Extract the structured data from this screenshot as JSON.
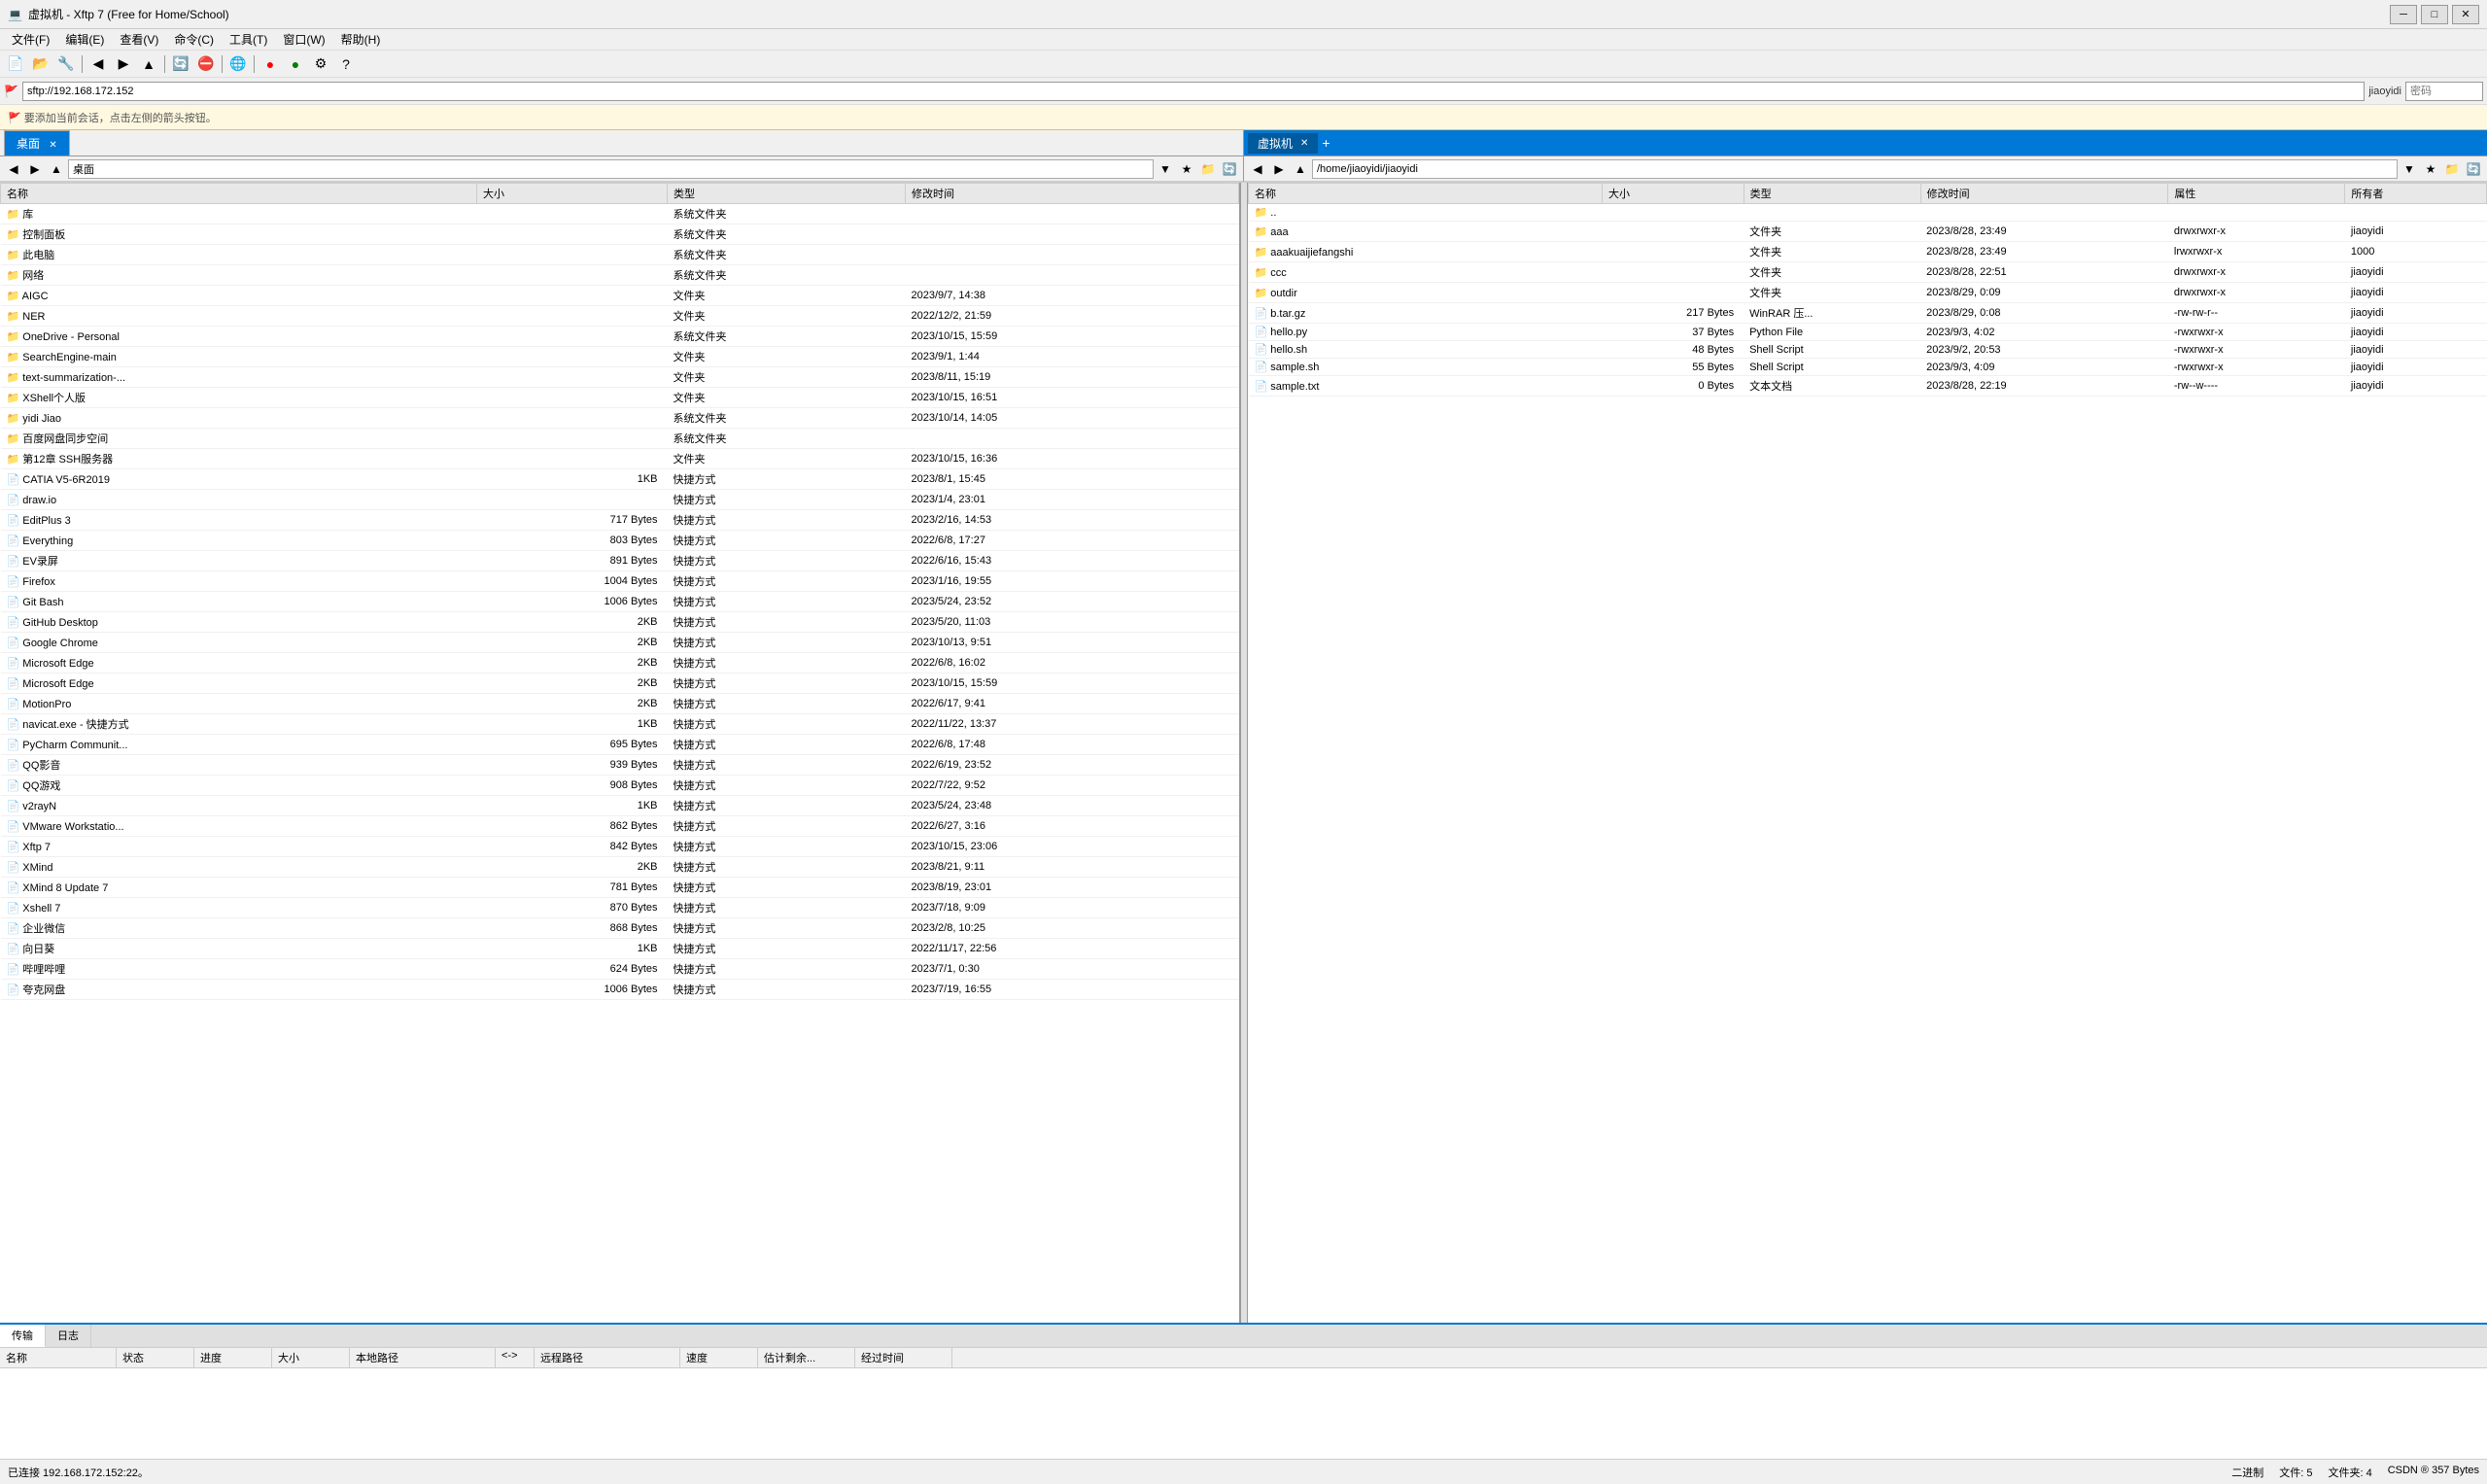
{
  "window": {
    "title": "虚拟机 - Xftp 7 (Free for Home/School)",
    "icon": "💻"
  },
  "menu": {
    "items": [
      "文件(F)",
      "编辑(E)",
      "查看(V)",
      "命令(C)",
      "工具(T)",
      "窗口(W)",
      "帮助(H)"
    ]
  },
  "sftp": {
    "address": "sftp://192.168.172.152",
    "user_label": "jiaoyidi",
    "password_label": "密码"
  },
  "warning": {
    "text": "🚩 要添加当前会话，点击左侧的箭头按钮。"
  },
  "left_panel": {
    "tab_label": "桌面",
    "path": "桌面",
    "path_input": "桌面",
    "columns": [
      "名称",
      "大小",
      "类型",
      "修改时间"
    ],
    "files": [
      {
        "name": "库",
        "size": "",
        "type": "系统文件夹",
        "modified": ""
      },
      {
        "name": "控制面板",
        "size": "",
        "type": "系统文件夹",
        "modified": ""
      },
      {
        "name": "此电脑",
        "size": "",
        "type": "系统文件夹",
        "modified": ""
      },
      {
        "name": "网络",
        "size": "",
        "type": "系统文件夹",
        "modified": ""
      },
      {
        "name": "AIGC",
        "size": "",
        "type": "文件夹",
        "modified": "2023/9/7, 14:38"
      },
      {
        "name": "NER",
        "size": "",
        "type": "文件夹",
        "modified": "2022/12/2, 21:59"
      },
      {
        "name": "OneDrive - Personal",
        "size": "",
        "type": "系统文件夹",
        "modified": "2023/10/15, 15:59"
      },
      {
        "name": "SearchEngine-main",
        "size": "",
        "type": "文件夹",
        "modified": "2023/9/1, 1:44"
      },
      {
        "name": "text-summarization-...",
        "size": "",
        "type": "文件夹",
        "modified": "2023/8/11, 15:19"
      },
      {
        "name": "XShell个人版",
        "size": "",
        "type": "文件夹",
        "modified": "2023/10/15, 16:51"
      },
      {
        "name": "yidi Jiao",
        "size": "",
        "type": "系统文件夹",
        "modified": "2023/10/14, 14:05"
      },
      {
        "name": "百度网盘同步空间",
        "size": "",
        "type": "系统文件夹",
        "modified": ""
      },
      {
        "name": "第12章 SSH服务器",
        "size": "",
        "type": "文件夹",
        "modified": "2023/10/15, 16:36"
      },
      {
        "name": "CATIA V5-6R2019",
        "size": "1KB",
        "type": "快捷方式",
        "modified": "2023/8/1, 15:45"
      },
      {
        "name": "draw.io",
        "size": "",
        "type": "快捷方式",
        "modified": "2023/1/4, 23:01"
      },
      {
        "name": "EditPlus 3",
        "size": "717 Bytes",
        "type": "快捷方式",
        "modified": "2023/2/16, 14:53"
      },
      {
        "name": "Everything",
        "size": "803 Bytes",
        "type": "快捷方式",
        "modified": "2022/6/8, 17:27"
      },
      {
        "name": "EV录屏",
        "size": "891 Bytes",
        "type": "快捷方式",
        "modified": "2022/6/16, 15:43"
      },
      {
        "name": "Firefox",
        "size": "1004 Bytes",
        "type": "快捷方式",
        "modified": "2023/1/16, 19:55"
      },
      {
        "name": "Git Bash",
        "size": "1006 Bytes",
        "type": "快捷方式",
        "modified": "2023/5/24, 23:52"
      },
      {
        "name": "GitHub Desktop",
        "size": "2KB",
        "type": "快捷方式",
        "modified": "2023/5/20, 11:03"
      },
      {
        "name": "Google Chrome",
        "size": "2KB",
        "type": "快捷方式",
        "modified": "2023/10/13, 9:51"
      },
      {
        "name": "Microsoft Edge",
        "size": "2KB",
        "type": "快捷方式",
        "modified": "2022/6/8, 16:02"
      },
      {
        "name": "Microsoft Edge",
        "size": "2KB",
        "type": "快捷方式",
        "modified": "2023/10/15, 15:59"
      },
      {
        "name": "MotionPro",
        "size": "2KB",
        "type": "快捷方式",
        "modified": "2022/6/17, 9:41"
      },
      {
        "name": "navicat.exe - 快捷方式",
        "size": "1KB",
        "type": "快捷方式",
        "modified": "2022/11/22, 13:37"
      },
      {
        "name": "PyCharm Communit...",
        "size": "695 Bytes",
        "type": "快捷方式",
        "modified": "2022/6/8, 17:48"
      },
      {
        "name": "QQ影音",
        "size": "939 Bytes",
        "type": "快捷方式",
        "modified": "2022/6/19, 23:52"
      },
      {
        "name": "QQ游戏",
        "size": "908 Bytes",
        "type": "快捷方式",
        "modified": "2022/7/22, 9:52"
      },
      {
        "name": "v2rayN",
        "size": "1KB",
        "type": "快捷方式",
        "modified": "2023/5/24, 23:48"
      },
      {
        "name": "VMware Workstatio...",
        "size": "862 Bytes",
        "type": "快捷方式",
        "modified": "2022/6/27, 3:16"
      },
      {
        "name": "Xftp 7",
        "size": "842 Bytes",
        "type": "快捷方式",
        "modified": "2023/10/15, 23:06"
      },
      {
        "name": "XMind",
        "size": "2KB",
        "type": "快捷方式",
        "modified": "2023/8/21, 9:11"
      },
      {
        "name": "XMind 8 Update 7",
        "size": "781 Bytes",
        "type": "快捷方式",
        "modified": "2023/8/19, 23:01"
      },
      {
        "name": "Xshell 7",
        "size": "870 Bytes",
        "type": "快捷方式",
        "modified": "2023/7/18, 9:09"
      },
      {
        "name": "企业微信",
        "size": "868 Bytes",
        "type": "快捷方式",
        "modified": "2023/2/8, 10:25"
      },
      {
        "name": "向日葵",
        "size": "1KB",
        "type": "快捷方式",
        "modified": "2022/11/17, 22:56"
      },
      {
        "name": "哔哩哔哩",
        "size": "624 Bytes",
        "type": "快捷方式",
        "modified": "2023/7/1, 0:30"
      },
      {
        "name": "夸克网盘",
        "size": "1006 Bytes",
        "type": "快捷方式",
        "modified": "2023/7/19, 16:55"
      }
    ]
  },
  "right_panel": {
    "tab_label": "虚拟机",
    "path": "/home/jiaoyidi/jiaoyidi",
    "path_input": "/home/jiaoyidi/jiaoyidi",
    "columns": [
      "名称",
      "大小",
      "类型",
      "修改时间",
      "属性",
      "所有者"
    ],
    "files": [
      {
        "name": "..",
        "size": "",
        "type": "",
        "modified": "",
        "attr": "",
        "owner": ""
      },
      {
        "name": "aaa",
        "size": "",
        "type": "文件夹",
        "modified": "2023/8/28, 23:49",
        "attr": "drwxrwxr-x",
        "owner": "jiaoyidi"
      },
      {
        "name": "aaakuaijiefangshi",
        "size": "",
        "type": "文件夹",
        "modified": "2023/8/28, 23:49",
        "attr": "lrwxrwxr-x",
        "owner": "1000"
      },
      {
        "name": "ccc",
        "size": "",
        "type": "文件夹",
        "modified": "2023/8/28, 22:51",
        "attr": "drwxrwxr-x",
        "owner": "jiaoyidi"
      },
      {
        "name": "outdir",
        "size": "",
        "type": "文件夹",
        "modified": "2023/8/29, 0:09",
        "attr": "drwxrwxr-x",
        "owner": "jiaoyidi"
      },
      {
        "name": "b.tar.gz",
        "size": "217 Bytes",
        "type": "WinRAR 压...",
        "modified": "2023/8/29, 0:08",
        "attr": "-rw-rw-r--",
        "owner": "jiaoyidi"
      },
      {
        "name": "hello.py",
        "size": "37 Bytes",
        "type": "Python File",
        "modified": "2023/9/3, 4:02",
        "attr": "-rwxrwxr-x",
        "owner": "jiaoyidi"
      },
      {
        "name": "hello.sh",
        "size": "48 Bytes",
        "type": "Shell Script",
        "modified": "2023/9/2, 20:53",
        "attr": "-rwxrwxr-x",
        "owner": "jiaoyidi"
      },
      {
        "name": "sample.sh",
        "size": "55 Bytes",
        "type": "Shell Script",
        "modified": "2023/9/3, 4:09",
        "attr": "-rwxrwxr-x",
        "owner": "jiaoyidi"
      },
      {
        "name": "sample.txt",
        "size": "0 Bytes",
        "type": "文本文档",
        "modified": "2023/8/28, 22:19",
        "attr": "-rw--w----",
        "owner": "jiaoyidi"
      }
    ]
  },
  "transfer": {
    "tabs": [
      "传输",
      "日志"
    ],
    "active_tab": "传输",
    "columns": [
      "名称",
      "状态",
      "进度",
      "大小",
      "本地路径",
      "<->",
      "远程路径",
      "速度",
      "估计剩余...",
      "经过时间"
    ],
    "items": []
  },
  "status": {
    "connection": "已连接 192.168.172.152:22。",
    "encoding": "二进制",
    "files_count": "文件: 5",
    "file_size": "文件夹: 4",
    "right_info": "CSDN ® 357 Bytes"
  }
}
